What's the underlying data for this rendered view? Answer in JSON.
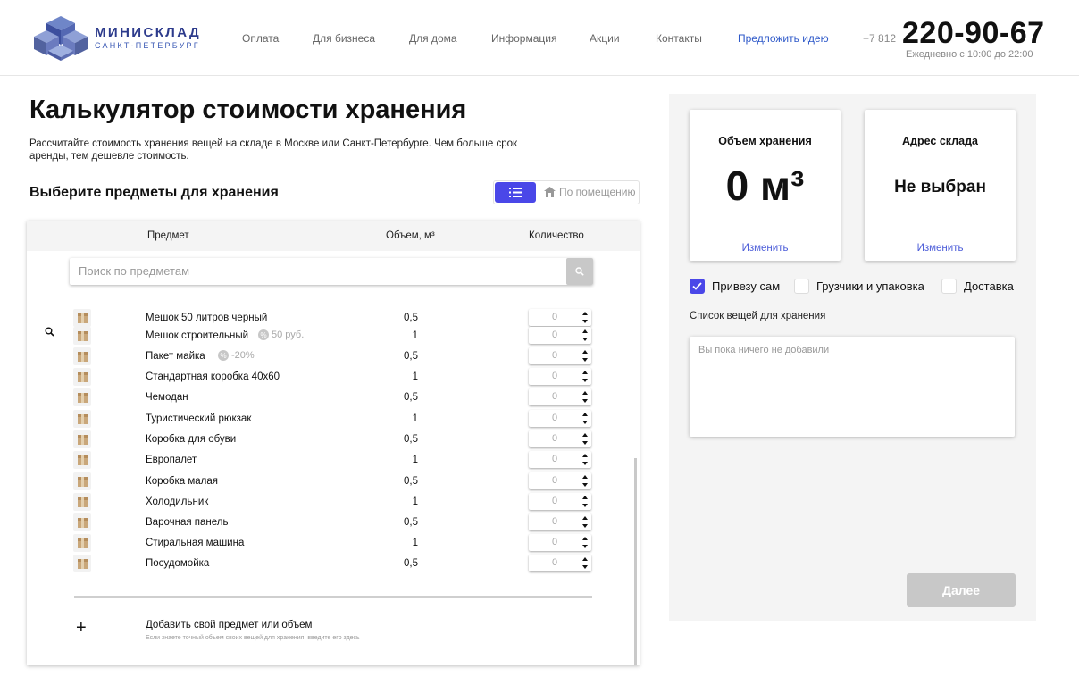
{
  "brand": {
    "name": "МИНИСКЛАД",
    "city": "САНКТ-ПЕТЕРБУРГ"
  },
  "nav": [
    "Оплата",
    "Для бизнеса",
    "Для дома",
    "Информация",
    "Акции",
    "Контакты",
    "Предложить идею"
  ],
  "phone": {
    "prefix": "+7 812",
    "number": "220-90-67",
    "hours": "Ежедневно с 10:00 до 22:00"
  },
  "page": {
    "title": "Калькулятор стоимости хранения",
    "description": "Рассчитайте стоимость хранения вещей на складе в Москве или Санкт-Петербурге. Чем больше срок аренды, тем дешевле стоимость.",
    "section_title": "Выберите предметы для хранения"
  },
  "view_toggle": {
    "list_icon": "list-icon",
    "room_icon": "house-icon",
    "room_label": "По помещению"
  },
  "table": {
    "headers": {
      "item": "Предмет",
      "volume": "Объем, м³",
      "quantity": "Количество"
    },
    "search_placeholder": "Поиск по предметам",
    "items": [
      {
        "name": "Мешок 50 литров черный",
        "volume": "0,5",
        "qty": "0"
      },
      {
        "name": "Мешок строительный",
        "volume": "1",
        "qty": "0",
        "badge": "50 руб."
      },
      {
        "name": "Пакет майка",
        "volume": "0,5",
        "qty": "0",
        "badge": "-20%"
      },
      {
        "name": "Стандартная коробка 40x60",
        "volume": "1",
        "qty": "0"
      },
      {
        "name": "Чемодан",
        "volume": "0,5",
        "qty": "0"
      },
      {
        "name": "Туристический рюкзак",
        "volume": "1",
        "qty": "0"
      },
      {
        "name": "Коробка для обуви",
        "volume": "0,5",
        "qty": "0"
      },
      {
        "name": "Европалет",
        "volume": "1",
        "qty": "0"
      },
      {
        "name": "Коробка малая",
        "volume": "0,5",
        "qty": "0"
      },
      {
        "name": "Холодильник",
        "volume": "1",
        "qty": "0"
      },
      {
        "name": "Варочная панель",
        "volume": "0,5",
        "qty": "0"
      },
      {
        "name": "Стиральная машина",
        "volume": "1",
        "qty": "0"
      },
      {
        "name": "Посудомойка",
        "volume": "0,5",
        "qty": "0"
      }
    ],
    "add_custom": {
      "title": "Добавить свой предмет или объем",
      "hint": "Если знаете точный объем своих вещей для хранения, введите его здесь"
    }
  },
  "summary": {
    "volume_card": {
      "title": "Объем хранения",
      "value": "0 м³",
      "link": "Изменить"
    },
    "address_card": {
      "title": "Адрес склада",
      "value": "Не выбран",
      "link": "Изменить"
    },
    "options": [
      {
        "label": "Привезу сам",
        "checked": true
      },
      {
        "label": "Грузчики и упаковка",
        "checked": false
      },
      {
        "label": "Доставка",
        "checked": false
      }
    ],
    "list_label": "Список вещей для хранения",
    "list_empty": "Вы пока ничего не добавили",
    "next_button": "Далее"
  },
  "colors": {
    "accent": "#4a47e8",
    "brand": "#2d3b8c",
    "link": "#4a5bd8"
  }
}
